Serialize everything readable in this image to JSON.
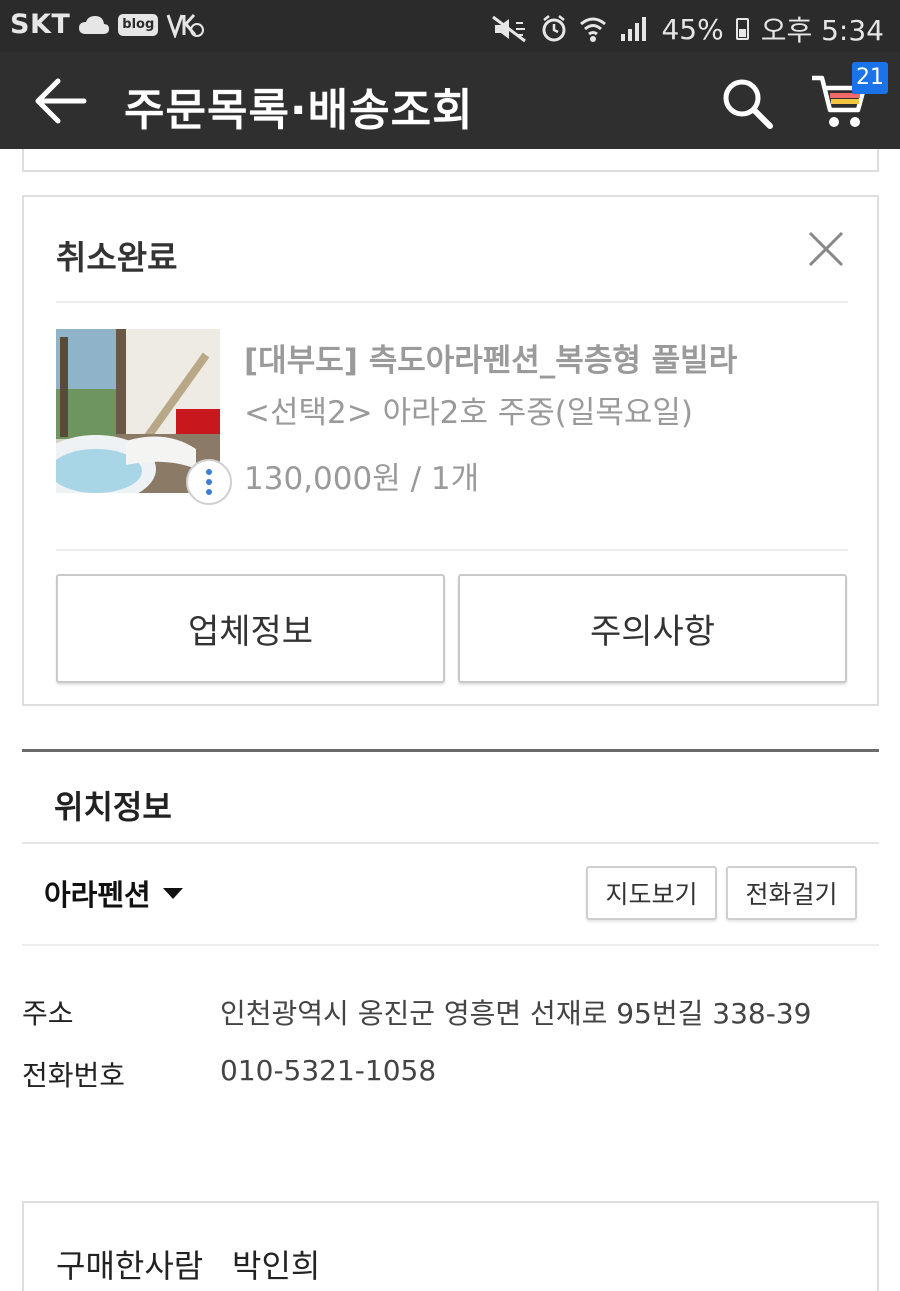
{
  "status_bar": {
    "carrier": "SKT",
    "blog_badge": "blog",
    "battery": "45%",
    "time": "오후 5:34"
  },
  "app_bar": {
    "title": "주문목록·배송조회",
    "cart_count": "21"
  },
  "order": {
    "status": "취소완료",
    "product_name": "[대부도] 측도아라펜션_복층형 풀빌라",
    "product_option": "<선택2> 아라2호 주중(일목요일)",
    "price_qty": "130,000원 / 1개",
    "company_info_label": "업체정보",
    "notice_label": "주의사항"
  },
  "location": {
    "title": "위치정보",
    "place_name": "아라펜션",
    "map_button": "지도보기",
    "call_button": "전화걸기",
    "address_label": "주소",
    "address_value": "인천광역시 옹진군 영흥면 선재로 95번길 338-39",
    "phone_label": "전화번호",
    "phone_value": "010-5321-1058"
  },
  "buyer": {
    "label": "구매한사람",
    "name": "박인희"
  },
  "colors": {
    "status_bar_bg": "#2b2b2b",
    "app_bar_bg": "#2f2f2f",
    "badge_blue": "#1a73e8",
    "muted_text": "#9a9a9a",
    "dot_blue": "#3b7dd8"
  },
  "icons": [
    "back-arrow-icon",
    "search-icon",
    "cart-icon",
    "close-icon",
    "more-vertical-icon",
    "caret-down-icon",
    "mute-icon",
    "alarm-icon",
    "wifi-icon",
    "signal-icon",
    "battery-icon",
    "cloud-icon"
  ]
}
